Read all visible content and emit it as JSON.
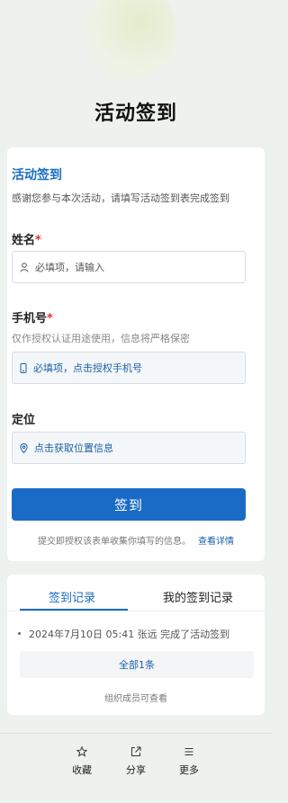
{
  "page": {
    "title": "活动签到"
  },
  "form": {
    "title": "活动签到",
    "description": "感谢您参与本次活动，请填写活动签到表完成签到",
    "name": {
      "label": "姓名",
      "required_mark": "*",
      "placeholder": "必填项，请输入"
    },
    "phone": {
      "label": "手机号",
      "required_mark": "*",
      "hint": "仅作授权认证用途使用，信息将严格保密",
      "placeholder": "必填项，点击授权手机号"
    },
    "location": {
      "label": "定位",
      "placeholder": "点击获取位置信息"
    },
    "submit_label": "签到",
    "footnote": "提交即授权该表单收集你填写的信息。",
    "footnote_link": "查看详情"
  },
  "records": {
    "tabs": [
      {
        "label": "签到记录",
        "active": true
      },
      {
        "label": "我的签到记录",
        "active": false
      }
    ],
    "items": [
      {
        "text": "2024年7月10日 05:41 张远 完成了活动签到"
      }
    ],
    "all_label": "全部1条",
    "member_note": "组织成员可查看"
  },
  "bottom_bar": [
    {
      "label": "收藏",
      "icon": "star-icon"
    },
    {
      "label": "分享",
      "icon": "share-icon"
    },
    {
      "label": "更多",
      "icon": "menu-icon"
    }
  ],
  "colors": {
    "accent": "#1a6bc6",
    "required": "#e0322f",
    "background": "#eef2ee"
  }
}
